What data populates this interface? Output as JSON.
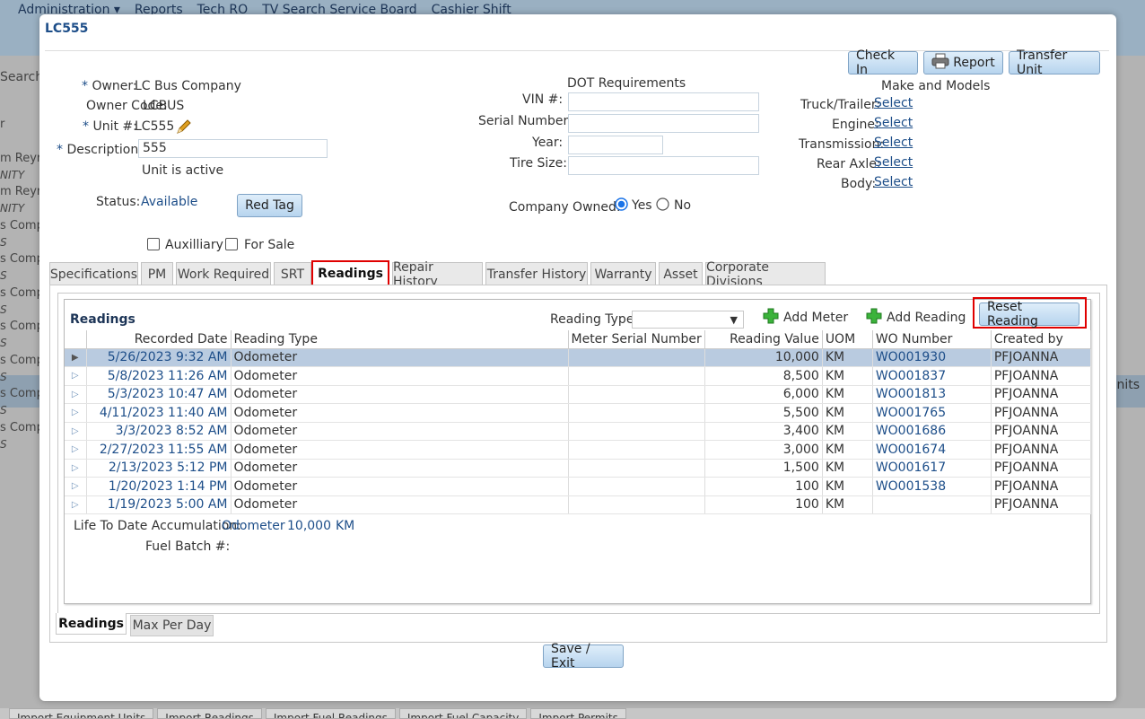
{
  "bg": {
    "menu": [
      "Administration ▾",
      "Reports",
      "Tech RO",
      "TV Search Service Board",
      "Cashier Shift"
    ],
    "search": "Search",
    "right_text": "nits",
    "rows": [
      {
        "a": "r",
        "b": ""
      },
      {
        "a": "m Reyr",
        "b": "NITY"
      },
      {
        "a": "m Reyr",
        "b": "NITY"
      },
      {
        "a": "s Comp",
        "b": "S"
      },
      {
        "a": "s Comp",
        "b": "S"
      },
      {
        "a": "s Comp",
        "b": "S"
      },
      {
        "a": "s Comp",
        "b": "S"
      },
      {
        "a": "s Comp",
        "b": "S"
      },
      {
        "a": "s Comp",
        "b": "S"
      },
      {
        "a": "s Comp",
        "b": "S"
      },
      {
        "a": "s Comp",
        "b": "S"
      }
    ],
    "bottom_tabs": [
      "Import Equipment Units",
      "Import Readings",
      "Import Fuel Readings",
      "Import Fuel Capacity",
      "Import Permits"
    ]
  },
  "modal": {
    "title": "LC555",
    "buttons": {
      "check_in": "Check In",
      "report": "Report",
      "transfer_unit": "Transfer Unit",
      "red_tag": "Red Tag",
      "save_exit": "Save / Exit"
    },
    "owner": {
      "label": "Owner:",
      "value": "LC Bus Company"
    },
    "owner_code": {
      "label": "Owner Code:",
      "value": "LCBUS"
    },
    "unit": {
      "label": "Unit #:",
      "value": "LC555"
    },
    "description": {
      "label": "Description:",
      "value": "555"
    },
    "unit_status_text": "Unit is active",
    "status": {
      "label": "Status:",
      "value": "Available"
    },
    "asterisk": "*",
    "auxilliary": "Auxilliary",
    "for_sale": "For Sale",
    "dot": {
      "heading": "DOT Requirements",
      "vin": "VIN #:",
      "serial": "Serial Number:",
      "year": "Year:",
      "tire": "Tire Size:"
    },
    "company_owned": {
      "label": "Company Owned:",
      "yes": "Yes",
      "no": "No",
      "selected": "Yes"
    },
    "make_models": {
      "heading": "Make and Models",
      "items": [
        {
          "label": "Truck/Trailer:",
          "link": "Select"
        },
        {
          "label": "Engine:",
          "link": "Select"
        },
        {
          "label": "Transmission:",
          "link": "Select"
        },
        {
          "label": "Rear Axle:",
          "link": "Select"
        },
        {
          "label": "Body:",
          "link": "Select"
        }
      ]
    },
    "tabs": [
      "Specifications",
      "PM",
      "Work Required",
      "SRT",
      "Readings",
      "Repair History",
      "Transfer History",
      "Warranty",
      "Asset",
      "Corporate Divisions"
    ],
    "active_tab": "Readings",
    "readings": {
      "title": "Readings",
      "reading_type_label": "Reading Type",
      "reading_type_value": "",
      "add_meter": "Add Meter",
      "add_reading": "Add Reading",
      "reset_reading": "Reset Reading",
      "columns": [
        "Recorded Date",
        "Reading Type",
        "Meter Serial Number",
        "Reading Value",
        "UOM",
        "WO Number",
        "Created by"
      ],
      "rows": [
        {
          "date": "5/26/2023 9:32 AM",
          "type": "Odometer",
          "serial": "",
          "value": "10,000",
          "uom": "KM",
          "wo": "WO001930",
          "by": "PFJOANNA"
        },
        {
          "date": "5/8/2023 11:26 AM",
          "type": "Odometer",
          "serial": "",
          "value": "8,500",
          "uom": "KM",
          "wo": "WO001837",
          "by": "PFJOANNA"
        },
        {
          "date": "5/3/2023 10:47 AM",
          "type": "Odometer",
          "serial": "",
          "value": "6,000",
          "uom": "KM",
          "wo": "WO001813",
          "by": "PFJOANNA"
        },
        {
          "date": "4/11/2023 11:40 AM",
          "type": "Odometer",
          "serial": "",
          "value": "5,500",
          "uom": "KM",
          "wo": "WO001765",
          "by": "PFJOANNA"
        },
        {
          "date": "3/3/2023 8:52 AM",
          "type": "Odometer",
          "serial": "",
          "value": "3,400",
          "uom": "KM",
          "wo": "WO001686",
          "by": "PFJOANNA"
        },
        {
          "date": "2/27/2023 11:55 AM",
          "type": "Odometer",
          "serial": "",
          "value": "3,000",
          "uom": "KM",
          "wo": "WO001674",
          "by": "PFJOANNA"
        },
        {
          "date": "2/13/2023 5:12 PM",
          "type": "Odometer",
          "serial": "",
          "value": "1,500",
          "uom": "KM",
          "wo": "WO001617",
          "by": "PFJOANNA"
        },
        {
          "date": "1/20/2023 1:14 PM",
          "type": "Odometer",
          "serial": "",
          "value": "100",
          "uom": "KM",
          "wo": "WO001538",
          "by": "PFJOANNA"
        },
        {
          "date": "1/19/2023 5:00 AM",
          "type": "Odometer",
          "serial": "",
          "value": "100",
          "uom": "KM",
          "wo": "",
          "by": "PFJOANNA"
        }
      ],
      "ltd": {
        "label": "Life To Date Accumulation:",
        "type": "Odometer",
        "value": "10,000",
        "uom": "KM"
      },
      "fuel_batch": {
        "label": "Fuel Batch #:",
        "value": ""
      },
      "bottom_tabs": [
        "Readings",
        "Max Per Day"
      ]
    }
  },
  "colors": {
    "accent": "#1d4e89",
    "highlight_border": "#e00000",
    "selected_row": "#b9cbe0"
  }
}
